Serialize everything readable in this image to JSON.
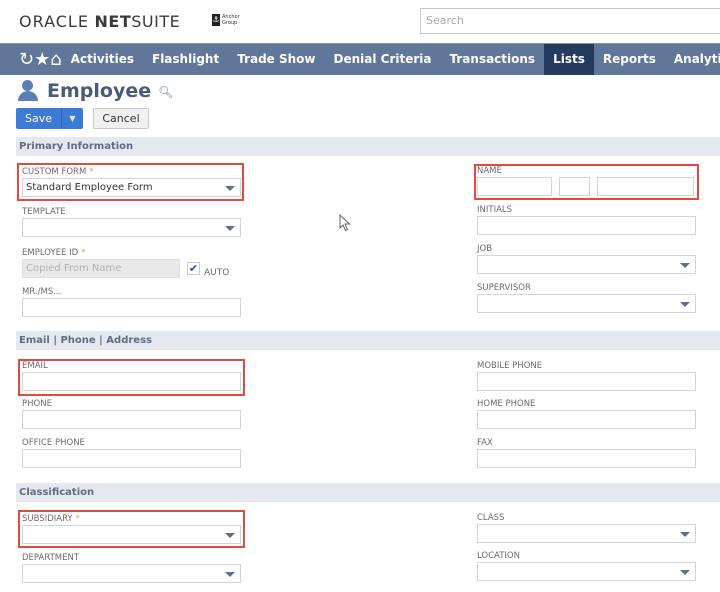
{
  "header": {
    "brand_oracle": "ORACLE",
    "brand_net": "NET",
    "brand_suite": "SUITE",
    "partner_logo_text": "Anchor Group",
    "search_placeholder": "Search"
  },
  "nav": {
    "icons": [
      "recent-history-icon",
      "star-icon",
      "home-icon"
    ],
    "items": [
      {
        "label": "Activities",
        "active": false
      },
      {
        "label": "Flashlight",
        "active": false
      },
      {
        "label": "Trade Show",
        "active": false
      },
      {
        "label": "Denial Criteria",
        "active": false
      },
      {
        "label": "Transactions",
        "active": false
      },
      {
        "label": "Lists",
        "active": true
      },
      {
        "label": "Reports",
        "active": false
      },
      {
        "label": "Analytics",
        "active": false
      }
    ]
  },
  "page": {
    "title": "Employee",
    "save_label": "Save",
    "save_dropdown_glyph": "▼",
    "cancel_label": "Cancel"
  },
  "sections": {
    "primary": "Primary Information",
    "contact": "Email | Phone | Address",
    "classification": "Classification"
  },
  "fields": {
    "custom_form": {
      "label": "CUSTOM FORM",
      "required": "*",
      "value": "Standard Employee Form"
    },
    "template": {
      "label": "TEMPLATE",
      "value": ""
    },
    "employee_id": {
      "label": "EMPLOYEE ID",
      "required": "*",
      "placeholder": "Copied From Name",
      "auto_label": "AUTO",
      "auto_checked": true
    },
    "mr_ms": {
      "label": "MR./MS...",
      "value": ""
    },
    "name": {
      "label": "NAME",
      "first": "",
      "middle": "",
      "last": ""
    },
    "initials": {
      "label": "INITIALS",
      "value": ""
    },
    "job": {
      "label": "JOB",
      "value": ""
    },
    "supervisor": {
      "label": "SUPERVISOR",
      "value": ""
    },
    "email": {
      "label": "EMAIL",
      "value": ""
    },
    "phone": {
      "label": "PHONE",
      "value": ""
    },
    "office_phone": {
      "label": "OFFICE PHONE",
      "value": ""
    },
    "mobile_phone": {
      "label": "MOBILE PHONE",
      "value": ""
    },
    "home_phone": {
      "label": "HOME PHONE",
      "value": ""
    },
    "fax": {
      "label": "FAX",
      "value": ""
    },
    "subsidiary": {
      "label": "SUBSIDIARY",
      "required": "*",
      "value": ""
    },
    "department": {
      "label": "DEPARTMENT",
      "value": ""
    },
    "class": {
      "label": "CLASS",
      "value": ""
    },
    "location": {
      "label": "LOCATION",
      "value": ""
    }
  },
  "colors": {
    "nav_bg": "#607799",
    "nav_active": "#243a5e",
    "primary_button": "#3c7ad6",
    "highlight_box": "#e14b3b",
    "required_star": "#e0a030"
  }
}
